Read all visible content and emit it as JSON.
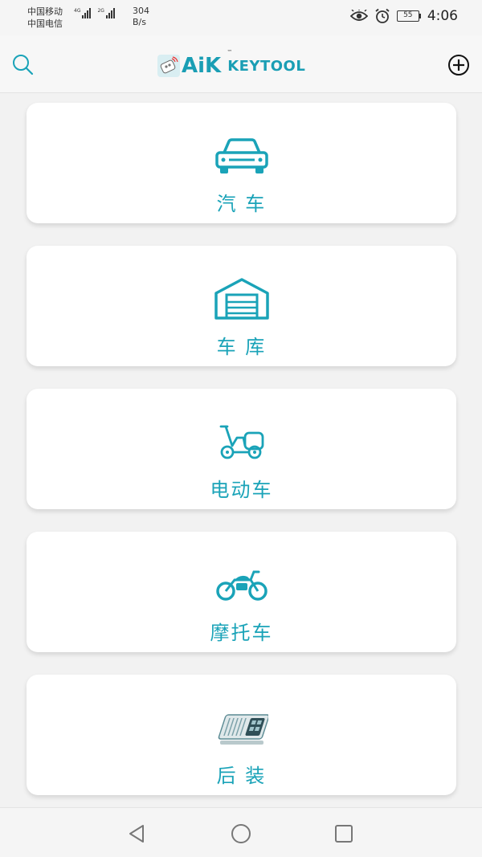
{
  "status_bar": {
    "carrier_1": "中国移动",
    "carrier_2": "中国电信",
    "net_1": "4G",
    "net_2": "2G",
    "speed_value": "304",
    "speed_unit": "B/s",
    "battery": "55",
    "time": "4:06",
    "icons": [
      "eye-icon",
      "alarm-icon"
    ]
  },
  "header": {
    "logo_main": "AiK",
    "logo_tm": "™",
    "logo_sub": "KEYTOOL",
    "icons": [
      "search-icon",
      "add-circle-icon"
    ]
  },
  "categories": [
    {
      "label": "汽 车",
      "icon": "car-icon"
    },
    {
      "label": "车 库",
      "icon": "garage-icon"
    },
    {
      "label": "电动车",
      "icon": "scooter-icon"
    },
    {
      "label": "摩托车",
      "icon": "motorcycle-icon"
    },
    {
      "label": "后 装",
      "icon": "remote-panel-icon"
    }
  ],
  "nav": {
    "icons": [
      "back-triangle-icon",
      "home-circle-icon",
      "recents-square-icon"
    ]
  },
  "colors": {
    "accent": "#1aa3b8",
    "background": "#f2f2f2",
    "card": "#ffffff"
  }
}
